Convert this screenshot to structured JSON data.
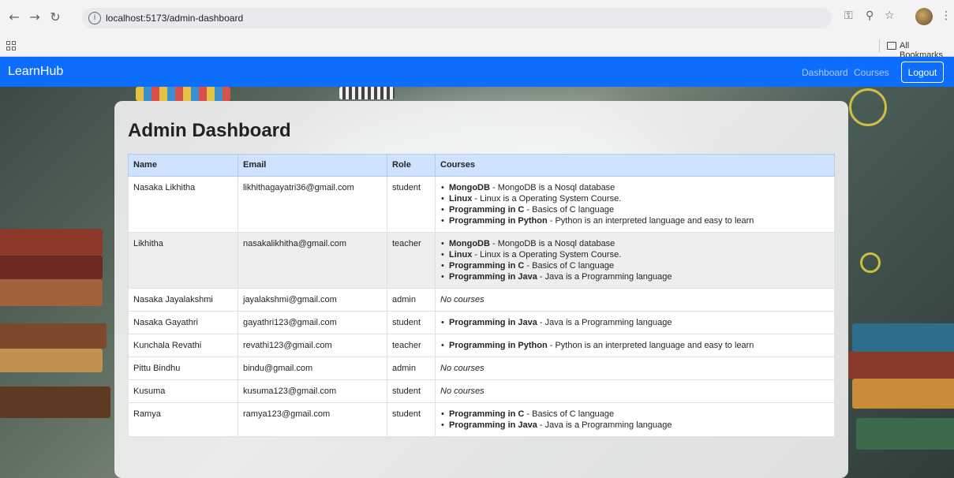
{
  "browser": {
    "url": "localhost:5173/admin-dashboard",
    "bookmarks_label": "All Bookmarks"
  },
  "navbar": {
    "brand": "LearnHub",
    "links": [
      "Dashboard",
      "Courses"
    ],
    "logout": "Logout",
    "color": "#0d6efd"
  },
  "page": {
    "title": "Admin Dashboard"
  },
  "table": {
    "headers": [
      "Name",
      "Email",
      "Role",
      "Courses"
    ],
    "header_color": "#cfe2ff",
    "rows": [
      {
        "name": "Nasaka Likhitha",
        "email": "likhithagayatri36@gmail.com",
        "role": "student",
        "courses": [
          {
            "title": "MongoDB",
            "desc": "MongoDB is a Nosql database"
          },
          {
            "title": "Linux",
            "desc": "Linux is a Operating System Course."
          },
          {
            "title": "Programming in C",
            "desc": "Basics of C language"
          },
          {
            "title": "Programming in Python",
            "desc": "Python is an interpreted language and easy to learn"
          }
        ]
      },
      {
        "name": "Likhitha",
        "email": "nasakalikhitha@gmail.com",
        "role": "teacher",
        "courses": [
          {
            "title": "MongoDB",
            "desc": "MongoDB is a Nosql database"
          },
          {
            "title": "Linux",
            "desc": "Linux is a Operating System Course."
          },
          {
            "title": "Programming in C",
            "desc": "Basics of C language"
          },
          {
            "title": "Programming in Java",
            "desc": "Java is a Programming language"
          }
        ]
      },
      {
        "name": "Nasaka Jayalakshmi",
        "email": "jayalakshmi@gmail.com",
        "role": "admin",
        "courses": [],
        "empty_text": "No courses"
      },
      {
        "name": "Nasaka Gayathri",
        "email": "gayathri123@gmail.com",
        "role": "student",
        "courses": [
          {
            "title": "Programming in Java",
            "desc": "Java is a Programming language"
          }
        ]
      },
      {
        "name": "Kunchala Revathi",
        "email": "revathi123@gmail.com",
        "role": "teacher",
        "courses": [
          {
            "title": "Programming in Python",
            "desc": "Python is an interpreted language and easy to learn"
          }
        ]
      },
      {
        "name": "Pittu Bindhu",
        "email": "bindu@gmail.com",
        "role": "admin",
        "courses": [],
        "empty_text": "No courses"
      },
      {
        "name": "Kusuma",
        "email": "kusuma123@gmail.com",
        "role": "student",
        "courses": [],
        "empty_text": "No courses"
      },
      {
        "name": "Ramya",
        "email": "ramya123@gmail.com",
        "role": "student",
        "courses": [
          {
            "title": "Programming in C",
            "desc": "Basics of C language"
          },
          {
            "title": "Programming in Java",
            "desc": "Java is a Programming language"
          }
        ]
      }
    ]
  }
}
